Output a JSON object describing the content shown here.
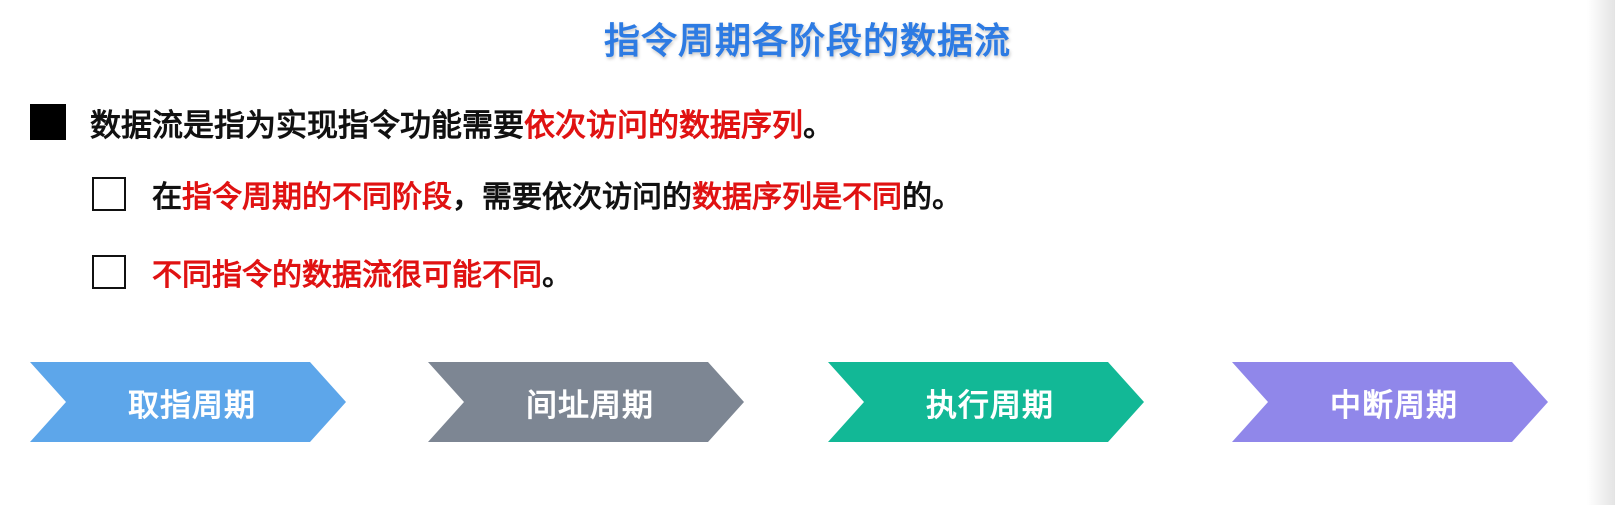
{
  "title": "指令周期各阶段的数据流",
  "bullets": [
    {
      "segments": [
        {
          "text": "数据流是指为实现指令功能需要",
          "red": false
        },
        {
          "text": "依次访问的数据序列",
          "red": true
        },
        {
          "text": "。",
          "red": false
        }
      ]
    },
    {
      "segments": [
        {
          "text": "在",
          "red": false
        },
        {
          "text": "指令周期的不同阶段",
          "red": true
        },
        {
          "text": "，需要依次访问的",
          "red": false
        },
        {
          "text": "数据序列是不同",
          "red": true
        },
        {
          "text": "的。",
          "red": false
        }
      ]
    },
    {
      "segments": [
        {
          "text": "不同指令的数据流很可能不同",
          "red": true
        },
        {
          "text": "。",
          "red": false
        }
      ]
    }
  ],
  "phases": [
    {
      "label": "取指周期",
      "color": "#5da6ea"
    },
    {
      "label": "间址周期",
      "color": "#7d8693"
    },
    {
      "label": "执行周期",
      "color": "#12b896"
    },
    {
      "label": "中断周期",
      "color": "#9087ea"
    }
  ]
}
